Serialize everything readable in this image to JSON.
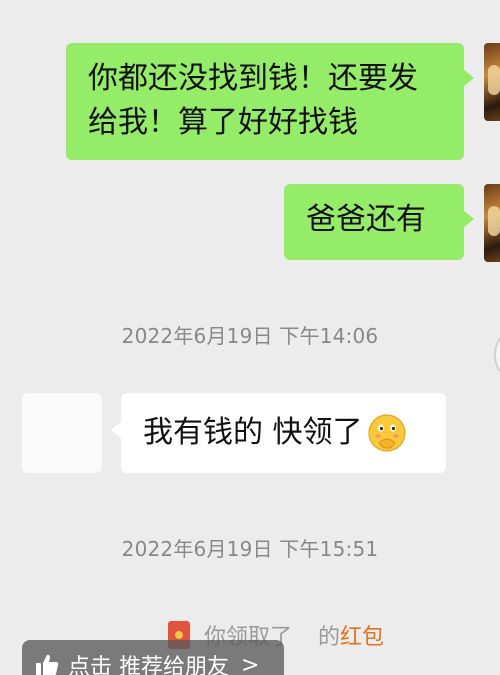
{
  "messages": [
    {
      "side": "right",
      "text_line1": "你都还没找到钱！还要发",
      "text_line2": "给我！算了好好找钱"
    },
    {
      "side": "right",
      "text": "爸爸还有"
    },
    {
      "side": "left",
      "text": "我有钱的 快领了",
      "emoji": "face-with-hand-over-mouth-emoji"
    }
  ],
  "timestamps": [
    "2022年6月19日 下午14:06",
    "2022年6月19日 下午15:51"
  ],
  "red_packet_notice": {
    "prefix": "你领取了",
    "middle": "的",
    "link": "红包"
  },
  "recommend_bar": {
    "label": "点击 推荐给朋友",
    "chevron": ">"
  },
  "colors": {
    "background": "#ececec",
    "outgoing_bubble": "#95ec69",
    "incoming_bubble": "#ffffff",
    "red_packet_link": "#e3711f"
  }
}
